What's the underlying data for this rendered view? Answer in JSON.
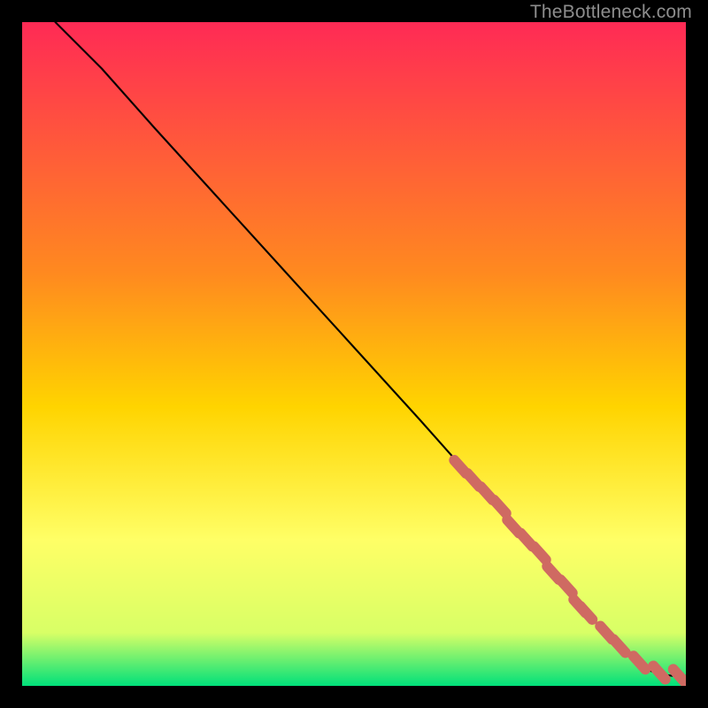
{
  "watermark": "TheBottleneck.com",
  "colors": {
    "top": "#ff2a55",
    "mid1": "#ff8a1f",
    "mid2": "#ffd400",
    "mid3": "#ffff66",
    "mid4": "#d8ff66",
    "bottom": "#00e07a",
    "curve": "#000000",
    "marker": "#cf6a62",
    "frame": "#000000"
  },
  "chart_data": {
    "type": "line",
    "title": "",
    "xlabel": "",
    "ylabel": "",
    "xlim": [
      0,
      100
    ],
    "ylim": [
      0,
      100
    ],
    "series": [
      {
        "name": "curve",
        "x": [
          5,
          8,
          12,
          20,
          30,
          40,
          50,
          60,
          68,
          74,
          80,
          84,
          88,
          92,
          94,
          96,
          98,
          100
        ],
        "y": [
          100,
          97,
          93,
          84,
          73,
          62,
          51,
          40,
          31,
          24,
          17,
          12,
          8,
          4,
          2.5,
          1.8,
          1.5,
          1.5
        ]
      }
    ],
    "markers": {
      "name": "highlighted-points",
      "x": [
        66,
        68,
        70,
        72,
        74,
        76,
        78,
        80,
        82,
        84,
        85,
        88,
        90,
        93,
        96,
        99
      ],
      "y": [
        33,
        31,
        29,
        27,
        24,
        22,
        20,
        17,
        15,
        12,
        11,
        8,
        6,
        3.5,
        2,
        1.5
      ]
    },
    "gradient_stops": [
      {
        "offset": 0.0,
        "key": "top"
      },
      {
        "offset": 0.38,
        "key": "mid1"
      },
      {
        "offset": 0.58,
        "key": "mid2"
      },
      {
        "offset": 0.78,
        "key": "mid3"
      },
      {
        "offset": 0.92,
        "key": "mid4"
      },
      {
        "offset": 1.0,
        "key": "bottom"
      }
    ]
  }
}
